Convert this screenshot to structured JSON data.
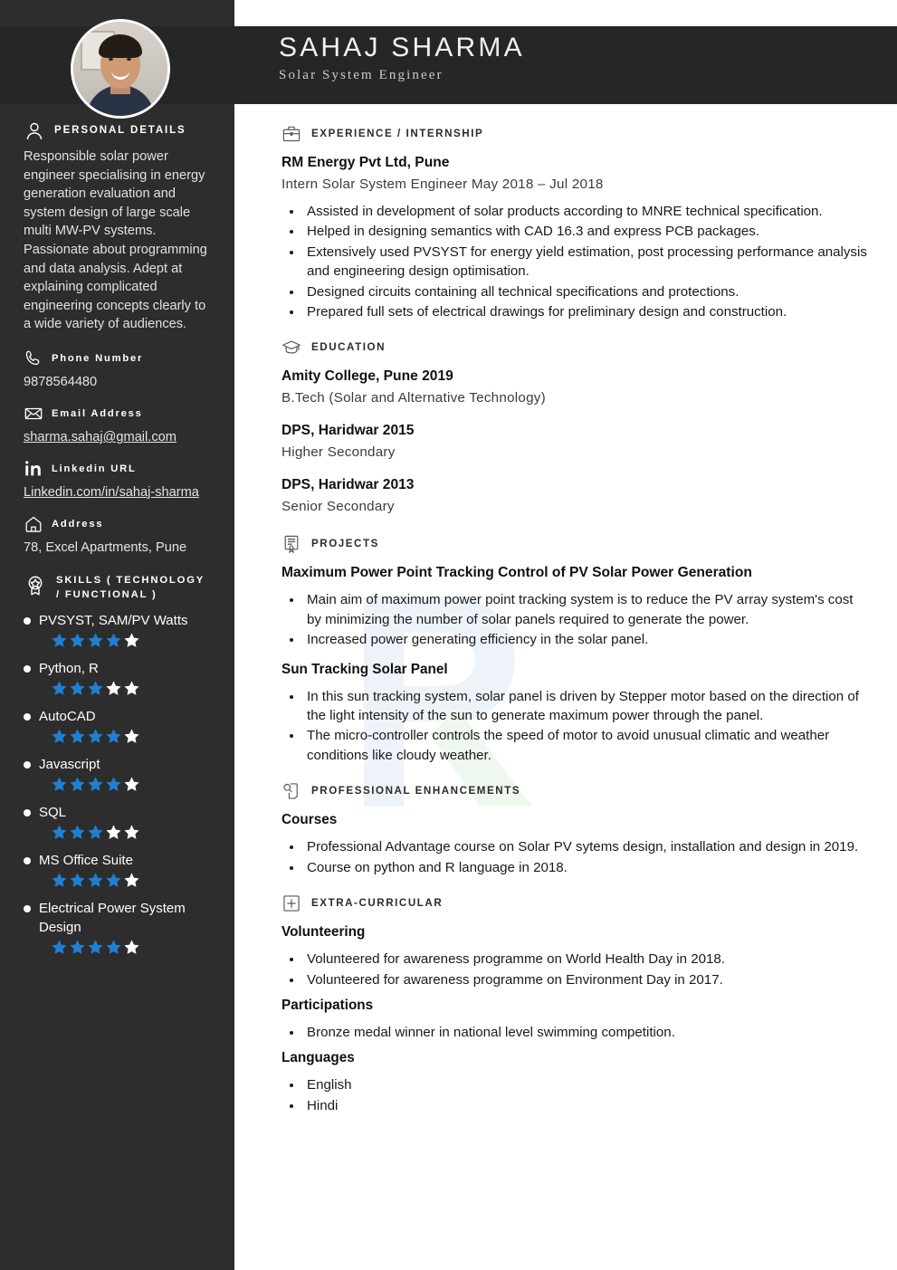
{
  "header": {
    "name": "SAHAJ SHARMA",
    "role": "Solar System Engineer",
    "avatar_icon": "profile-photo"
  },
  "sidebar": {
    "personal_details": {
      "icon": "person-icon",
      "title": "PERSONAL DETAILS",
      "summary": "Responsible solar power engineer specialising in energy generation evaluation and system design of large scale multi MW-PV systems. Passionate about programming and data analysis. Adept at explaining complicated engineering concepts clearly to a wide variety of audiences."
    },
    "contacts": [
      {
        "icon": "phone-icon",
        "label": "Phone Number",
        "value": "9878564480",
        "is_link": false
      },
      {
        "icon": "envelope-icon",
        "label": "Email Address",
        "value": "sharma.sahaj@gmail.com",
        "is_link": true
      },
      {
        "icon": "linkedin-icon",
        "label": "Linkedin URL",
        "value": "Linkedin.com/in/sahaj-sharma",
        "is_link": true
      },
      {
        "icon": "home-icon",
        "label": "Address",
        "value": "78, Excel Apartments, Pune",
        "is_link": false
      }
    ],
    "skills_section": {
      "icon": "award-badge-icon",
      "title": "SKILLS ( TECHNOLOGY / FUNCTIONAL )",
      "max_rating": 5,
      "items": [
        {
          "name": "PVSYST, SAM/PV Watts",
          "rating": 4
        },
        {
          "name": "Python, R",
          "rating": 3
        },
        {
          "name": "AutoCAD",
          "rating": 4
        },
        {
          "name": "Javascript",
          "rating": 4
        },
        {
          "name": "SQL",
          "rating": 3
        },
        {
          "name": "MS Office Suite",
          "rating": 4
        },
        {
          "name": "Electrical Power System Design",
          "rating": 4
        }
      ]
    }
  },
  "main": {
    "experience": {
      "icon": "briefcase-icon",
      "title": "EXPERIENCE / INTERNSHIP",
      "company": "RM Energy Pvt Ltd, Pune",
      "role_dates": "Intern Solar System Engineer May 2018 – Jul 2018",
      "bullets": [
        "Assisted in development of solar products according to MNRE technical specification.",
        "Helped in designing semantics with CAD 16.3 and express PCB packages.",
        "Extensively used PVSYST for energy yield estimation, post processing performance analysis and engineering design optimisation.",
        "Designed circuits containing all technical specifications and protections.",
        "Prepared full sets of electrical drawings for preliminary design and construction."
      ]
    },
    "education": {
      "icon": "graduation-cap-icon",
      "title": "EDUCATION",
      "entries": [
        {
          "school": "Amity College, Pune 2019",
          "degree": "B.Tech (Solar and Alternative Technology)"
        },
        {
          "school": "DPS, Haridwar 2015",
          "degree": "Higher Secondary"
        },
        {
          "school": "DPS, Haridwar 2013",
          "degree": "Senior Secondary"
        }
      ]
    },
    "projects": {
      "icon": "certificate-icon",
      "title": "PROJECTS",
      "entries": [
        {
          "name": "Maximum Power Point Tracking Control of PV Solar Power Generation",
          "bullets": [
            "Main aim of maximum power point tracking system is to reduce the PV array system's cost by minimizing the number of solar panels required to generate the power.",
            "Increased power generating efficiency in the solar panel."
          ]
        },
        {
          "name": "Sun Tracking Solar Panel",
          "bullets": [
            "In this sun tracking system, solar panel is driven by Stepper motor based on the direction of the light intensity of the sun to generate maximum power through the panel.",
            "The micro-controller controls the speed of motor to avoid unusual climatic and weather conditions like cloudy weather."
          ]
        }
      ]
    },
    "professional_enhancements": {
      "icon": "magnifier-document-icon",
      "title": "PROFESSIONAL ENHANCEMENTS",
      "groups": [
        {
          "name": "Courses",
          "bullets": [
            "Professional Advantage course on Solar PV sytems design, installation and design in 2019.",
            "Course on python and R language in 2018."
          ]
        }
      ]
    },
    "extra_curricular": {
      "icon": "plus-box-icon",
      "title": "EXTRA-CURRICULAR",
      "groups": [
        {
          "name": "Volunteering",
          "bullets": [
            "Volunteered for awareness programme on World Health Day in 2018.",
            "Volunteered for awareness programme on Environment Day in 2017."
          ]
        },
        {
          "name": "Participations",
          "bullets": [
            "Bronze medal winner in national level swimming competition."
          ]
        },
        {
          "name": "Languages",
          "bullets": [
            "English",
            "Hindi"
          ]
        }
      ]
    }
  },
  "colors": {
    "sidebar_bg": "#2d2d2d",
    "header_bg": "#262626",
    "star_filled": "#1f7fd4",
    "star_empty": "#ffffff",
    "text_light": "#e6e4e1",
    "text_dark": "#1a1a1a"
  }
}
